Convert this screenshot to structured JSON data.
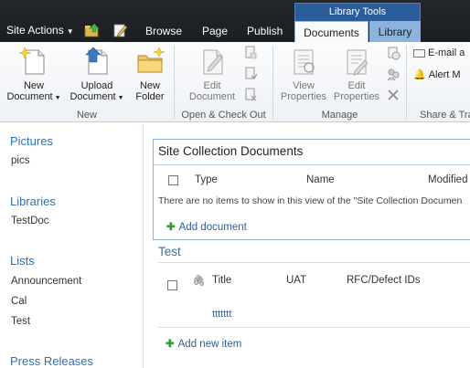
{
  "topbar": {
    "site_actions": "Site Actions",
    "tabs": [
      "Browse",
      "Page",
      "Publish"
    ],
    "context_group": "Library Tools",
    "context_tabs": [
      "Documents",
      "Library"
    ]
  },
  "ribbon": {
    "groups": {
      "new": {
        "label": "New",
        "new_document": [
          "New",
          "Document"
        ],
        "upload_document": [
          "Upload",
          "Document"
        ],
        "new_folder": [
          "New",
          "Folder"
        ]
      },
      "open_checkout": {
        "label": "Open & Check Out",
        "edit_document": [
          "Edit",
          "Document"
        ]
      },
      "manage": {
        "label": "Manage",
        "view_properties": [
          "View",
          "Properties"
        ],
        "edit_properties": [
          "Edit",
          "Properties"
        ]
      },
      "share": {
        "label": "Share & Tra",
        "email_link": "E-mail a",
        "alert_me": "Alert M"
      }
    }
  },
  "leftnav": {
    "pictures": "Pictures",
    "pics": "pics",
    "libraries": "Libraries",
    "testdoc": "TestDoc",
    "lists": "Lists",
    "announcement": "Announcement",
    "cal": "Cal",
    "test": "Test",
    "press_releases": "Press Releases"
  },
  "site_docs": {
    "title": "Site Collection Documents",
    "columns": [
      "Type",
      "Name",
      "Modified"
    ],
    "empty_message": "There are no items to show in this view of the \"Site Collection Documen",
    "add_label": "Add document"
  },
  "test_list": {
    "title": "Test",
    "columns": [
      "Title",
      "UAT",
      "RFC/Defect IDs"
    ],
    "row_title": "ttttttt",
    "add_label": "Add new item"
  },
  "colors": {
    "topbar": "#1b1e22",
    "context_group": "#2b5d9a",
    "library_tab": "#8db3dd",
    "nav_heading": "#2f70b0",
    "link": "#2f5f9a",
    "add_plus": "#3a9a3a"
  }
}
